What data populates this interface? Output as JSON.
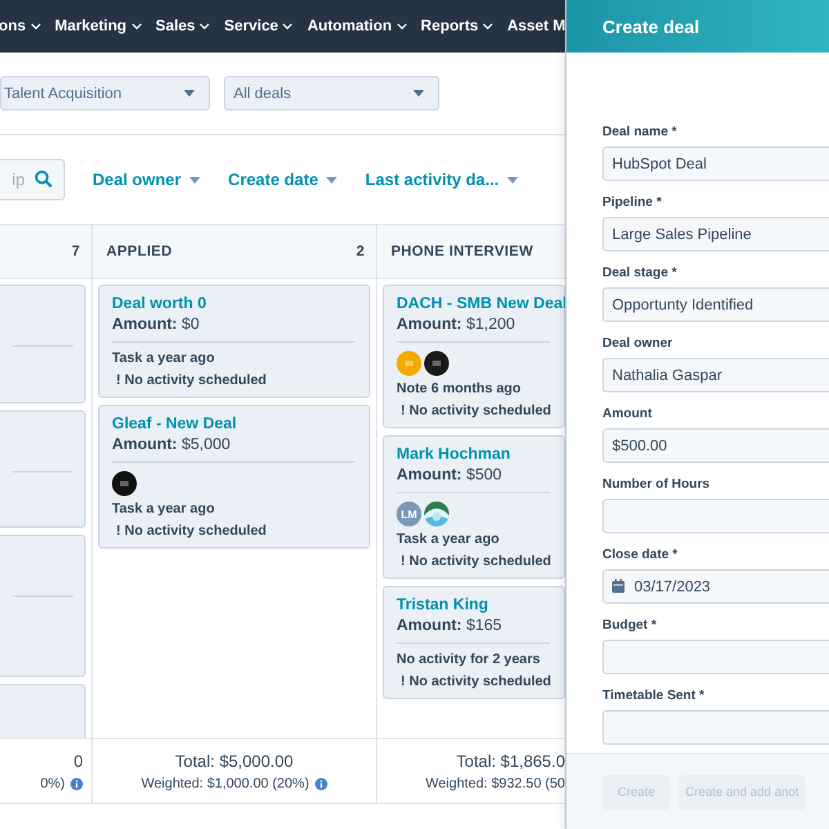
{
  "nav": {
    "items": [
      {
        "label": "ons",
        "caret": true
      },
      {
        "label": "Marketing",
        "caret": true
      },
      {
        "label": "Sales",
        "caret": true
      },
      {
        "label": "Service",
        "caret": true
      },
      {
        "label": "Automation",
        "caret": true
      },
      {
        "label": "Reports",
        "caret": true
      },
      {
        "label": "Asset M",
        "caret": false
      }
    ]
  },
  "filters": [
    {
      "value": "Talent Acquisition"
    },
    {
      "value": "All deals"
    }
  ],
  "toolbar": {
    "search": {
      "placeholder": "ip"
    },
    "filters": [
      {
        "label": "Deal owner"
      },
      {
        "label": "Create date"
      },
      {
        "label": "Last activity da..."
      }
    ]
  },
  "columns": [
    {
      "count": "7",
      "cards": [
        {
          "kind": "blank"
        },
        {
          "kind": "blank"
        },
        {
          "kind": "blank"
        },
        {
          "kind": "blank"
        }
      ],
      "total": "0",
      "weighted": "0%)",
      "info_icon": true
    },
    {
      "name": "APPLIED",
      "count": "2",
      "cards": [
        {
          "kind": "deal",
          "title": "Deal worth 0",
          "amount": "**Amount:** $0",
          "activity": "Task a year ago",
          "next": "! No activity scheduled"
        },
        {
          "kind": "deal",
          "title": "Gleaf - New Deal",
          "amount": "**Amount:** $5,000",
          "avatars": [
            {
              "kind": "logo",
              "color": "#111111"
            }
          ],
          "activity": "Task a year ago",
          "next": "! No activity scheduled"
        }
      ],
      "total": "Total: $5,000.00",
      "weighted": "Weighted: $1,000.00 (20%)",
      "info_icon": true
    },
    {
      "name": "PHONE INTERVIEW",
      "cards": [
        {
          "kind": "deal",
          "title": "DACH - SMB New Deal",
          "amount": "**Amount:** $1,200",
          "avatars": [
            {
              "kind": "logo",
              "color": "#f2a900"
            },
            {
              "kind": "logo",
              "color": "#1a1a1a"
            }
          ],
          "activity": "Note 6 months ago",
          "next": "! No activity scheduled"
        },
        {
          "kind": "deal",
          "title": "Mark Hochman",
          "amount": "**Amount:** $500",
          "avatars": [
            {
              "kind": "initials",
              "initials": "LM"
            },
            {
              "kind": "picture"
            }
          ],
          "activity": "Task a year ago",
          "next": "! No activity scheduled"
        },
        {
          "kind": "deal",
          "title": "Tristan King",
          "amount": "**Amount:** $165",
          "activity": "No activity for 2 years",
          "next": "! No activity scheduled"
        }
      ],
      "total": "Total: $1,865.0",
      "weighted": "Weighted: $932.50 (50",
      "info_icon": false
    }
  ],
  "panel": {
    "title": "Create deal",
    "fields": [
      {
        "label": "Deal name *",
        "kind": "text",
        "value": "HubSpot Deal"
      },
      {
        "label": "Pipeline *",
        "kind": "text",
        "value": "Large Sales Pipeline"
      },
      {
        "label": "Deal stage *",
        "kind": "text",
        "value": "Opportunty Identified"
      },
      {
        "label": "Deal owner",
        "kind": "text",
        "value": "Nathalia Gaspar"
      },
      {
        "label": "Amount",
        "kind": "text",
        "value": "$500.00"
      },
      {
        "label": "Number of Hours",
        "kind": "text"
      },
      {
        "label": "Close date *",
        "kind": "date",
        "value": "03/17/2023"
      },
      {
        "label": "Budget *",
        "kind": "text"
      },
      {
        "label": "Timetable Sent *",
        "kind": "text"
      }
    ],
    "buttons": [
      {
        "label": "Create",
        "disabled": true
      },
      {
        "label": "Create and add anot",
        "disabled": true
      }
    ]
  }
}
